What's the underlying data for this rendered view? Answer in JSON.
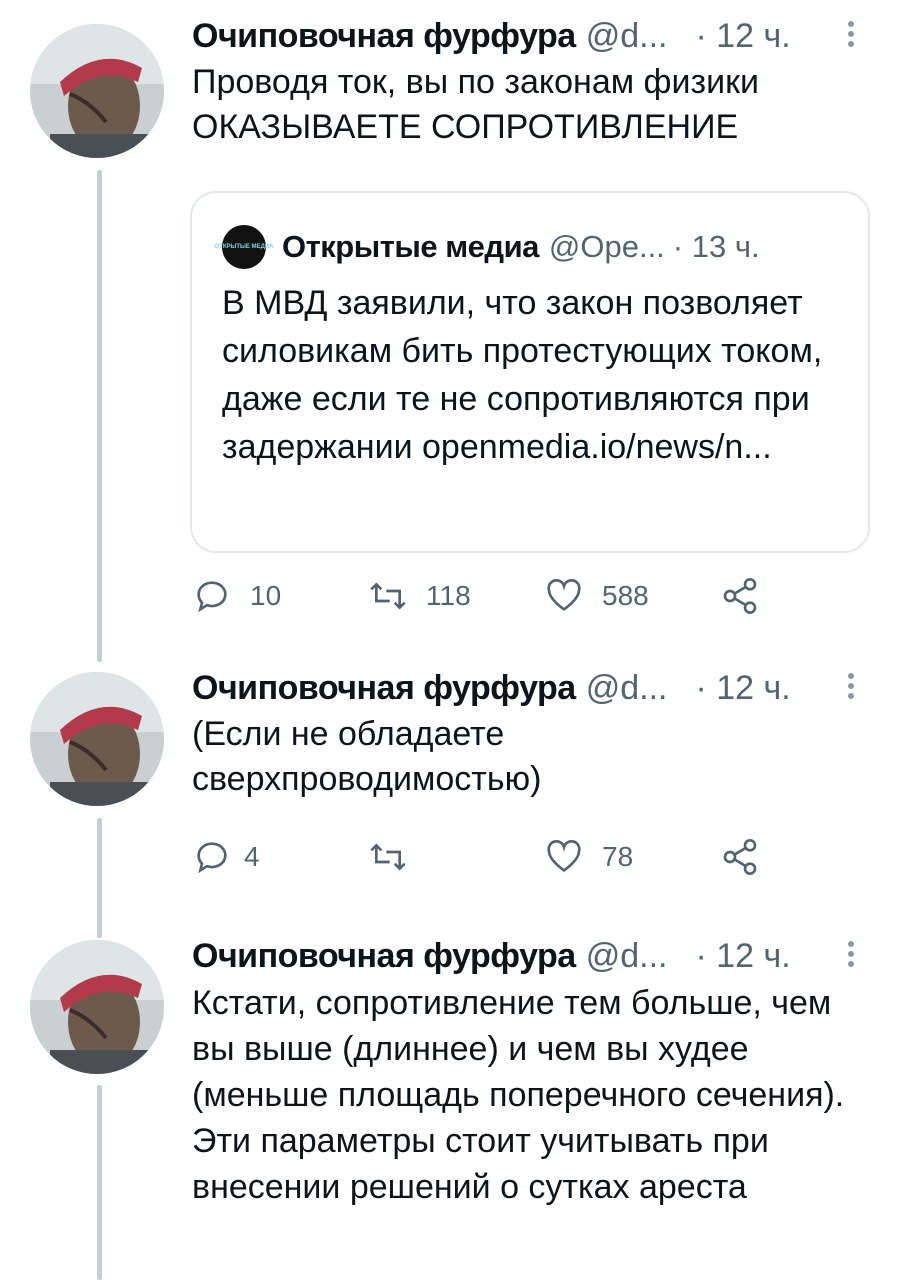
{
  "tweets": [
    {
      "name": "Очиповочная фурфура",
      "handle": "@d...",
      "time": "· 12 ч.",
      "text": "Проводя ток, вы по законам физики ОКАЗЫВАЕТЕ СОПРОТИВЛЕНИЕ",
      "quote": {
        "logo_text": "ОТКРЫТЫЕ МЕДИА",
        "name": "Открытые медиа",
        "handle": "@Ope...",
        "time": "· 13 ч.",
        "text": "В МВД заявили, что закон позволяет силовикам бить протестующих током, даже если те не сопротивляются при задержании openmedia.io/news/n..."
      },
      "replies": "10",
      "retweets": "118",
      "likes": "588"
    },
    {
      "name": "Очиповочная фурфура",
      "handle": "@d...",
      "time": "· 12 ч.",
      "text": "(Если не обладаете сверхпроводимостью)",
      "replies": "4",
      "retweets": "",
      "likes": "78"
    },
    {
      "name": "Очиповочная фурфура",
      "handle": "@d...",
      "time": "· 12 ч.",
      "text": "Кстати, сопротивление тем больше, чем вы выше (длиннее) и чем вы худее (меньше площадь поперечного сечения). Эти параметры стоит учитывать при внесении решений о сутках ареста"
    }
  ],
  "icons": {
    "reply": "reply-icon",
    "retweet": "retweet-icon",
    "like": "heart-icon",
    "share": "share-icon",
    "more": "more-icon"
  },
  "colors": {
    "secondary_text": "#536471",
    "thread_line": "#c4cfd6",
    "border": "#e3e8eb"
  }
}
